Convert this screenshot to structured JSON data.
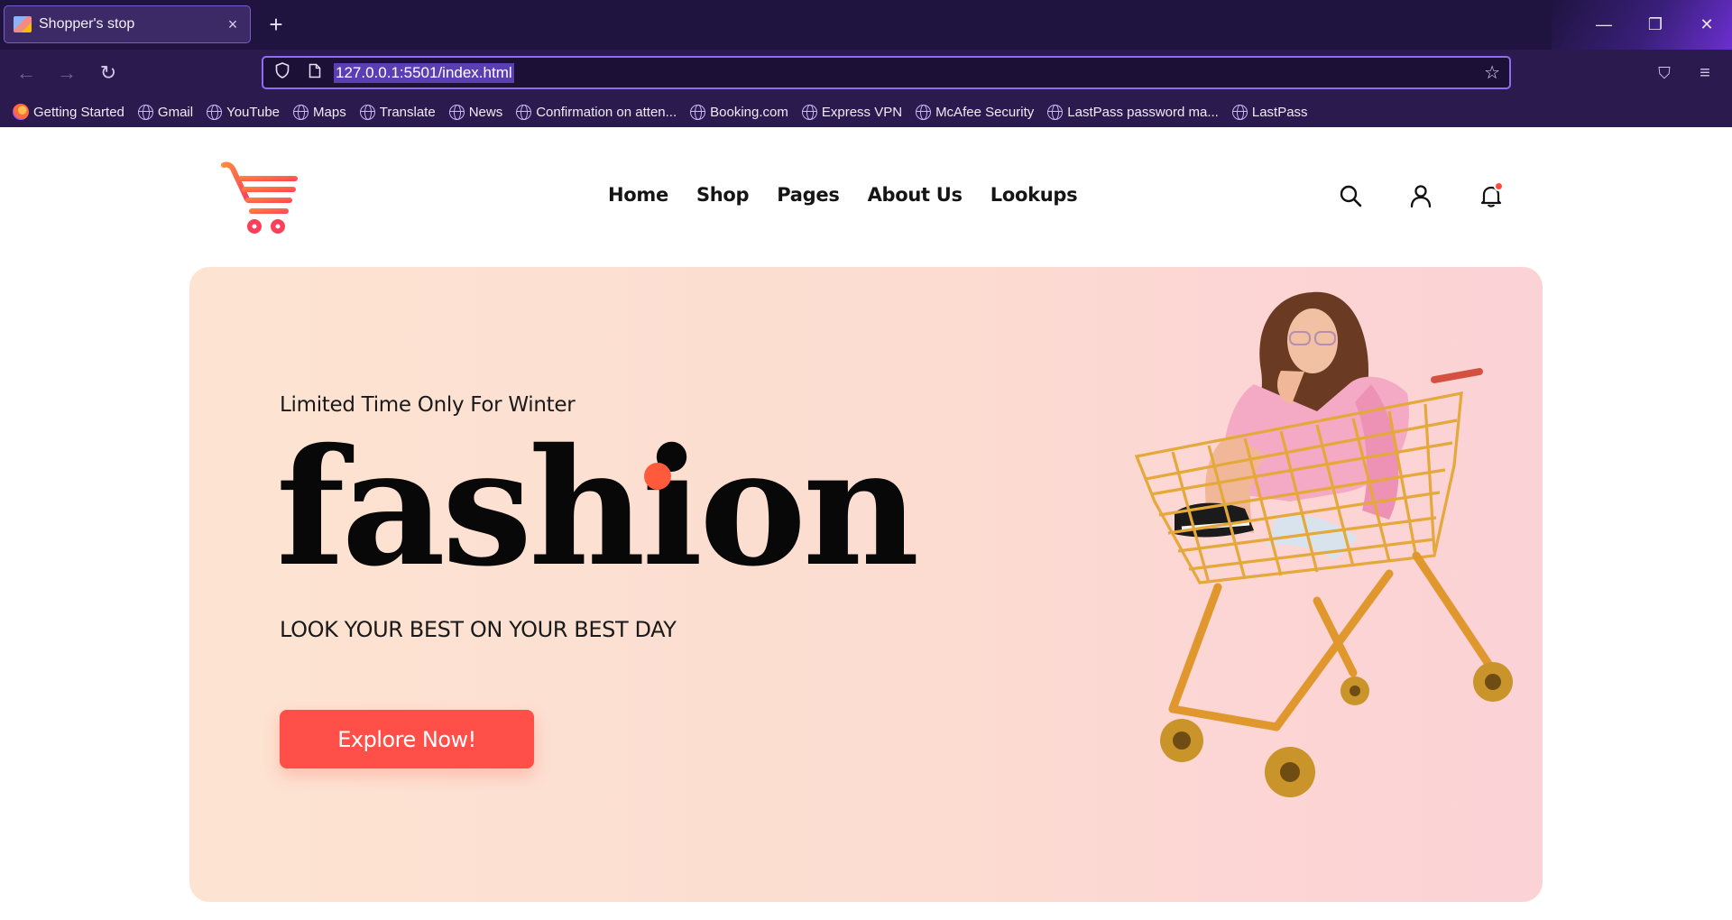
{
  "browser": {
    "tab_title": "Shopper's stop",
    "tab_close": "×",
    "new_tab": "+",
    "window_controls": {
      "minimize": "—",
      "maximize": "❐",
      "close": "✕"
    },
    "nav": {
      "back": "←",
      "forward": "→",
      "reload": "↻",
      "pocket": "⛉",
      "menu": "≡"
    },
    "url": "127.0.0.1:5501/index.html",
    "bookmarks": [
      "Getting Started",
      "Gmail",
      "YouTube",
      "Maps",
      "Translate",
      "News",
      "Confirmation on atten...",
      "Booking.com",
      "Express VPN",
      "McAfee Security",
      "LastPass password ma...",
      "LastPass"
    ]
  },
  "site": {
    "nav": [
      "Home",
      "Shop",
      "Pages",
      "About Us",
      "Lookups"
    ],
    "icons": [
      "search-icon",
      "user-icon",
      "bell-icon"
    ],
    "colors": {
      "accent": "#ff4f48",
      "hero_bg": "#fde4d2",
      "chrome": "#2b1a4e"
    }
  },
  "hero": {
    "eyebrow": "Limited Time Only For Winter",
    "title": "fashion",
    "subtitle": "LOOK YOUR BEST ON YOUR BEST DAY",
    "button": "Explore Now!"
  }
}
